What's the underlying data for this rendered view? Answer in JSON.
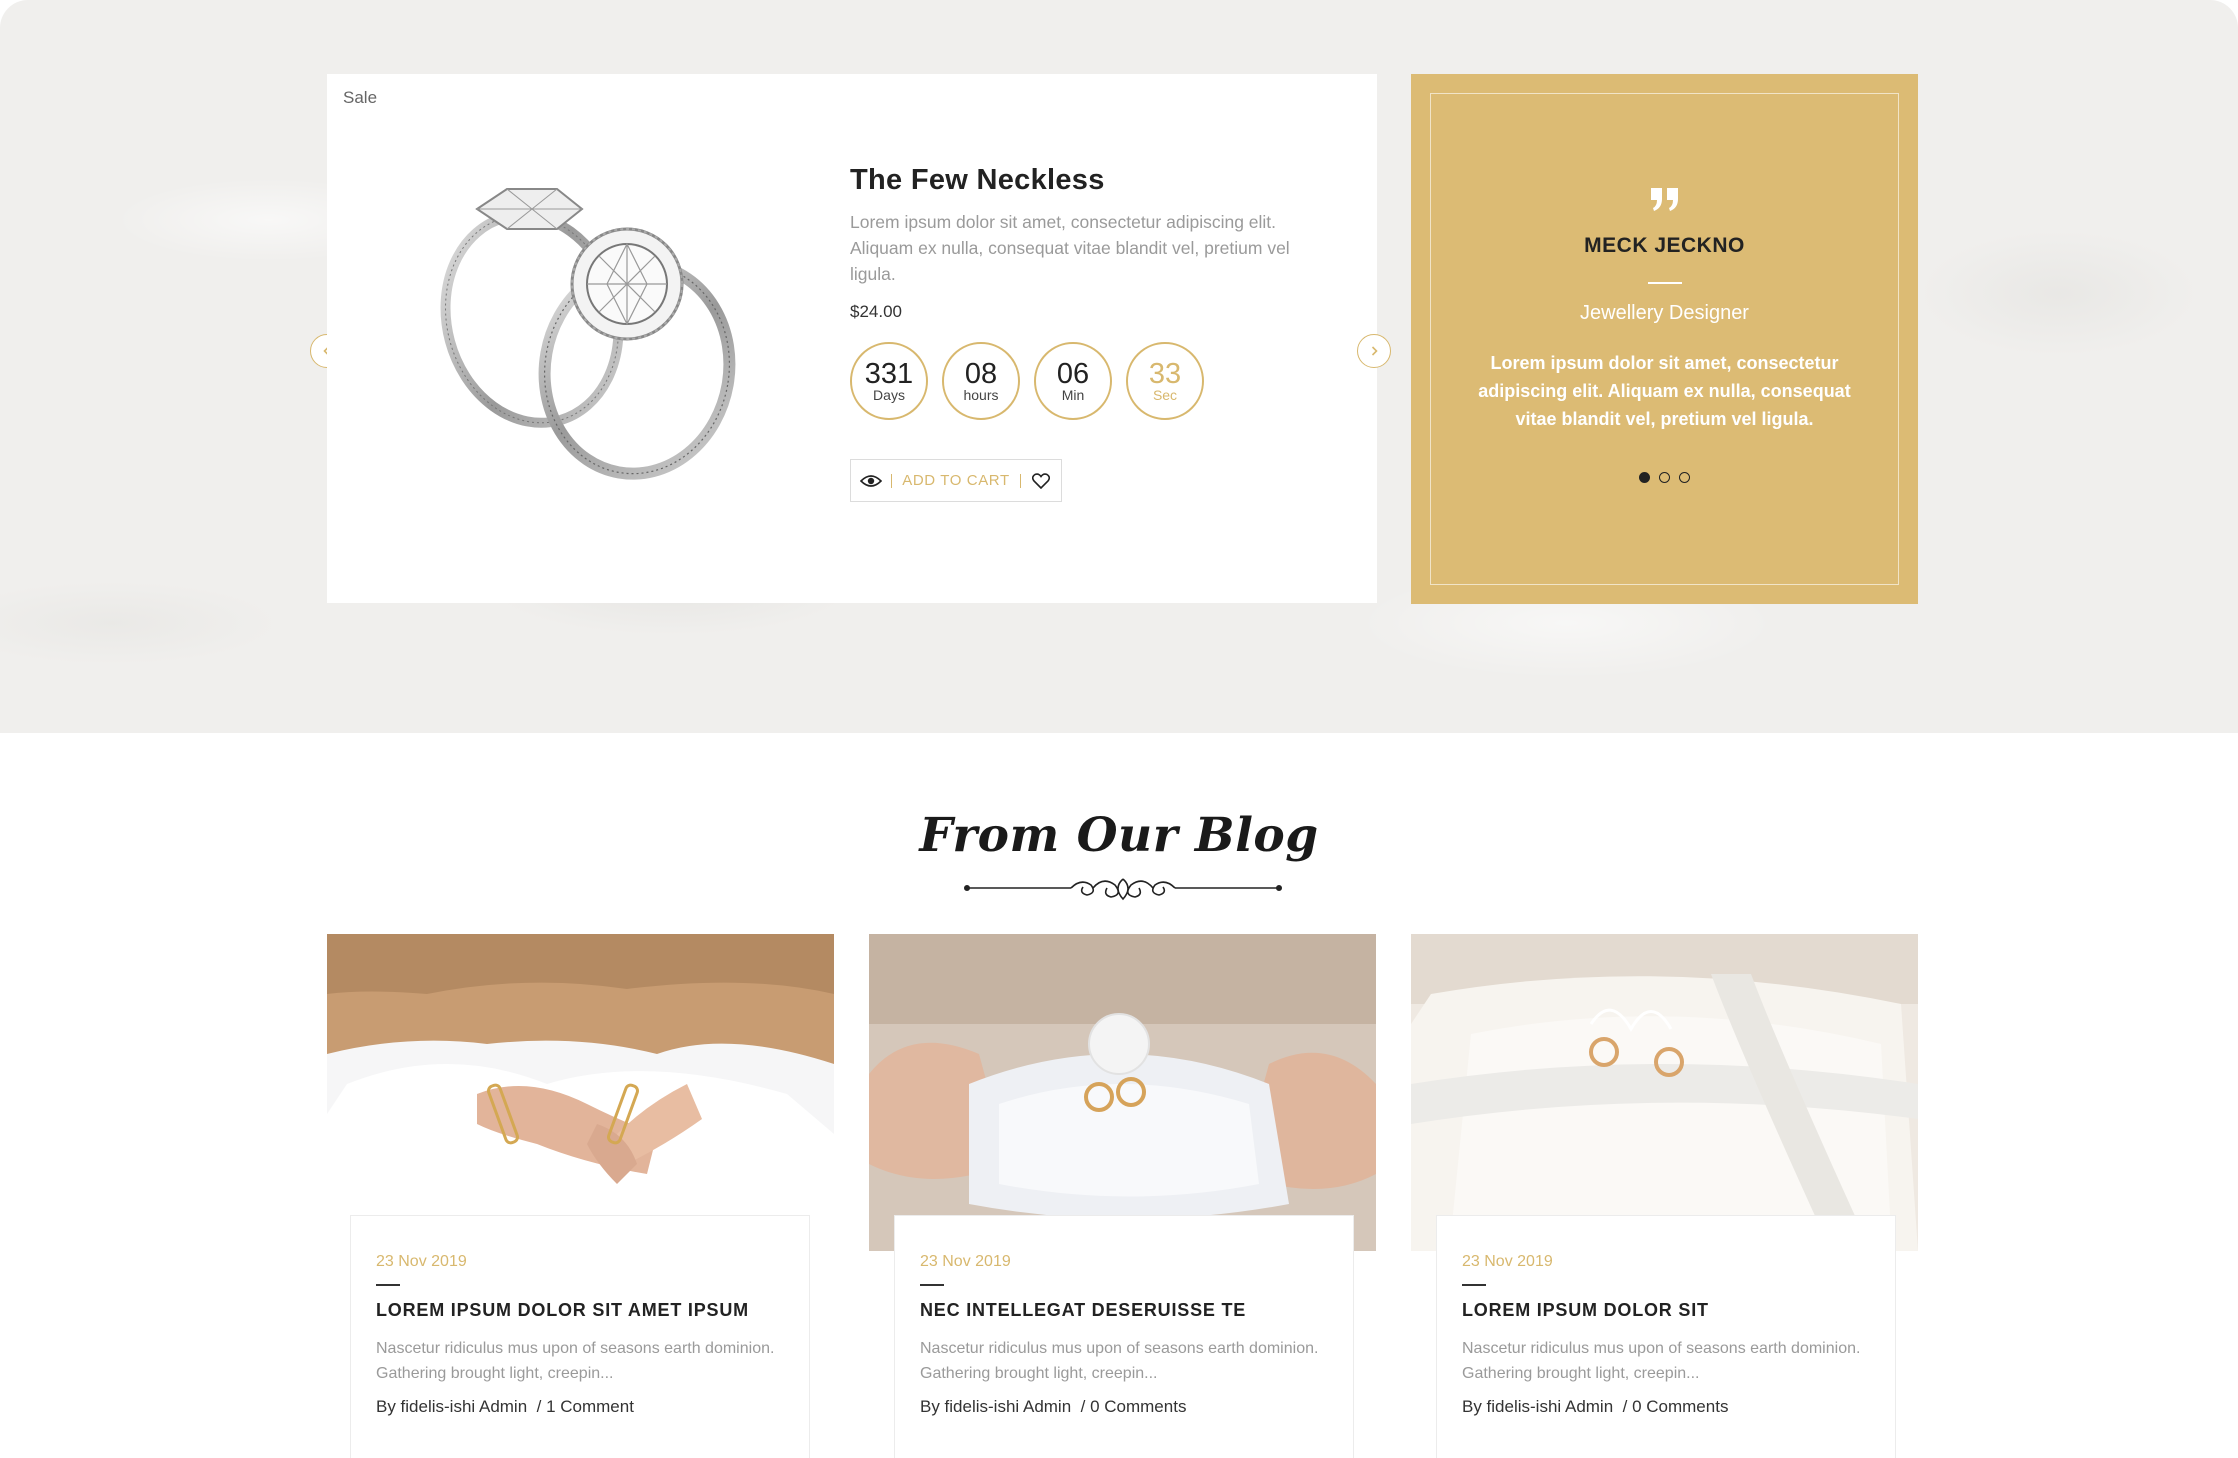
{
  "deal": {
    "sale_label": "Sale",
    "title": "The Few Neckless",
    "description": "Lorem ipsum dolor sit amet, consectetur adipiscing elit. Aliquam ex nulla, consequat vitae blandit vel, pretium vel ligula.",
    "price": "$24.00",
    "countdown": {
      "days": {
        "value": "331",
        "label": "Days"
      },
      "hours": {
        "value": "08",
        "label": "hours"
      },
      "minutes": {
        "value": "06",
        "label": "Min"
      },
      "seconds": {
        "value": "33",
        "label": "Sec"
      }
    },
    "add_to_cart_label": "ADD TO CART"
  },
  "testimonial": {
    "name": "MECK JECKNO",
    "role": "Jewellery Designer",
    "text": "Lorem ipsum dolor sit amet, consectetur adipiscing elit. Aliquam ex nulla, consequat vitae blandit vel, pretium vel ligula.",
    "dots_count": 3,
    "active_dot": 1
  },
  "blog": {
    "title": "From Our Blog",
    "posts": [
      {
        "date": "23 Nov 2019",
        "title": "LOREM IPSUM DOLOR SIT AMET IPSUM",
        "excerpt": "Nascetur ridiculus mus upon of seasons earth dominion. Gathering brought light, creepin...",
        "author": "By fidelis-ishi Admin",
        "comments": "1 Comment"
      },
      {
        "date": "23 Nov 2019",
        "title": "NEC INTELLEGAT DESERUISSE TE",
        "excerpt": "Nascetur ridiculus mus upon of seasons earth dominion. Gathering brought light, creepin...",
        "author": "By fidelis-ishi Admin",
        "comments": "0 Comments"
      },
      {
        "date": "23 Nov 2019",
        "title": "LOREM IPSUM DOLOR SIT",
        "excerpt": "Nascetur ridiculus mus upon of seasons earth dominion. Gathering brought light, creepin...",
        "author": "By fidelis-ishi Admin",
        "comments": "0 Comments"
      }
    ]
  },
  "colors": {
    "accent_gold": "#d8b86e",
    "testimonial_bg": "#dcbb74",
    "section_bg": "#f0efed"
  },
  "icons": [
    "chevron-left-icon",
    "chevron-right-icon",
    "eye-icon",
    "heart-icon",
    "quote-icon",
    "ornament-divider"
  ]
}
